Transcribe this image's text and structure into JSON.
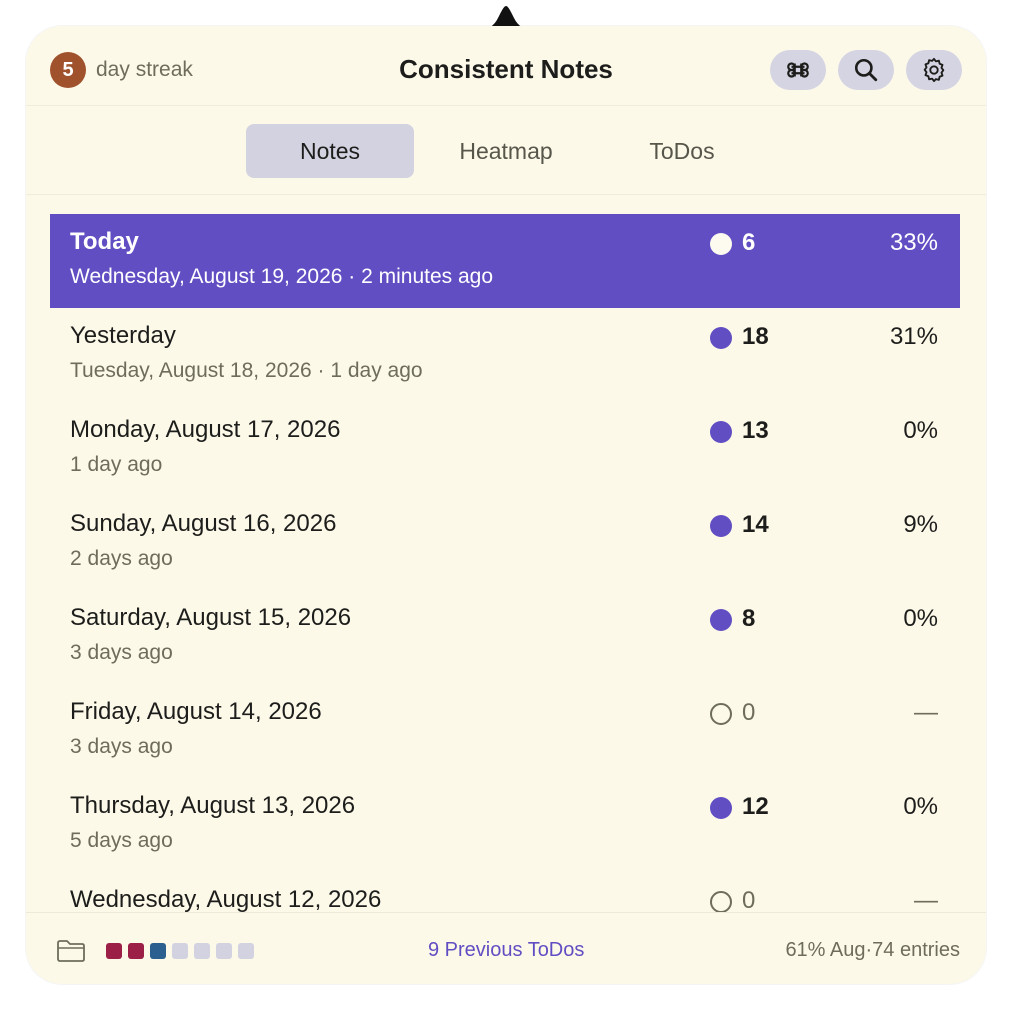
{
  "app": {
    "title": "Consistent Notes",
    "streak_count": "5",
    "streak_label": "day streak"
  },
  "toolbar": {
    "shortcut_icon": "command-icon",
    "search_icon": "search-icon",
    "settings_icon": "gear-icon"
  },
  "tabs": [
    {
      "label": "Notes",
      "active": true
    },
    {
      "label": "Heatmap",
      "active": false
    },
    {
      "label": "ToDos",
      "active": false
    }
  ],
  "entries": [
    {
      "title": "Today",
      "subtitle": "Wednesday, August 19, 2026 · 2 minutes ago",
      "count": "6",
      "percent": "33%",
      "selected": true
    },
    {
      "title": "Yesterday",
      "subtitle": "Tuesday, August 18, 2026 · 1 day ago",
      "count": "18",
      "percent": "31%"
    },
    {
      "title": "Monday, August 17, 2026",
      "subtitle": "1 day ago",
      "count": "13",
      "percent": "0%"
    },
    {
      "title": "Sunday, August 16, 2026",
      "subtitle": "2 days ago",
      "count": "14",
      "percent": "9%"
    },
    {
      "title": "Saturday, August 15, 2026",
      "subtitle": "3 days ago",
      "count": "8",
      "percent": "0%"
    },
    {
      "title": "Friday, August 14, 2026",
      "subtitle": "3 days ago",
      "count": "0",
      "percent": "—",
      "empty": true
    },
    {
      "title": "Thursday, August 13, 2026",
      "subtitle": "5 days ago",
      "count": "12",
      "percent": "0%"
    },
    {
      "title": "Wednesday, August 12, 2026",
      "subtitle": "",
      "count": "0",
      "percent": "—",
      "empty": true
    }
  ],
  "footer": {
    "folder_icon": "folder-icon",
    "swatch_colors": [
      "#9c1f48",
      "#9c1f48",
      "#2a5f8f",
      "#d3d2e0",
      "#d3d2e0",
      "#d3d2e0",
      "#d3d2e0"
    ],
    "previous_todos": "9 Previous ToDos",
    "stats": "61% Aug·74 entries"
  },
  "colors": {
    "accent": "#624ec3",
    "background": "#fcf9e9",
    "streak_badge": "#a0522d"
  }
}
